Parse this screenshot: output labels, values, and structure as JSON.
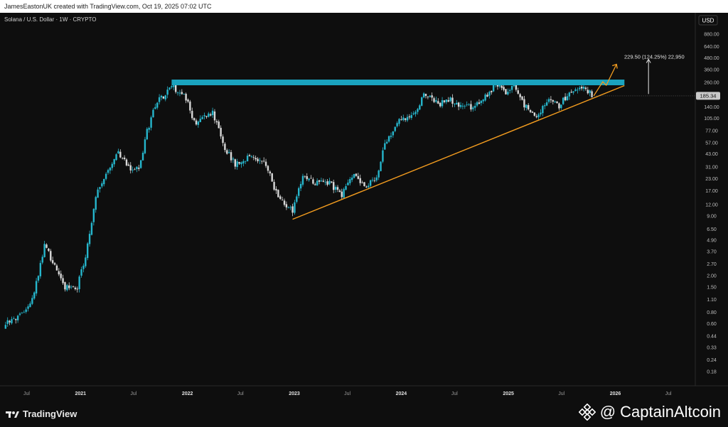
{
  "header": {
    "credit": "JamesEastonUK created with TradingView.com, Oct 19, 2025 07:02 UTC"
  },
  "symbol": {
    "title": "Solana / U.S. Dollar · 1W · CRYPTO"
  },
  "currency_button": "USD",
  "price_tag": "185.34",
  "projection_label": "229.50 (124.25%) 22,950",
  "footer": {
    "tv_brand": "TradingView",
    "watermark": "@ CaptainAltcoin"
  },
  "colors": {
    "background": "#0e0e0e",
    "candle_up": "#26b6cc",
    "candle_down": "#d9d9d9",
    "resistance": "#1aa3bf",
    "trendline": "#f39c1f"
  },
  "chart_data": {
    "type": "candlestick",
    "title": "Solana / U.S. Dollar · 1W · CRYPTO",
    "y_scale": "log",
    "ylim": [
      0.15,
      1300
    ],
    "y_ticks": [
      0.18,
      0.24,
      0.33,
      0.44,
      0.6,
      0.8,
      1.1,
      1.5,
      2.0,
      2.7,
      3.7,
      4.9,
      6.5,
      9.0,
      12.0,
      17.0,
      23.0,
      31.0,
      43.0,
      57.0,
      77.0,
      105.0,
      140.0,
      190.0,
      260.0,
      360.0,
      480.0,
      640.0,
      880.0
    ],
    "x_ticks": [
      "Jul",
      "2021",
      "Jul",
      "2022",
      "Jul",
      "2023",
      "Jul",
      "2024",
      "Jul",
      "2025",
      "Jul",
      "2026",
      "Jul"
    ],
    "x_tick_dates": [
      "2020-07-01",
      "2021-01-01",
      "2021-07-01",
      "2022-01-01",
      "2022-07-01",
      "2023-01-01",
      "2023-07-01",
      "2024-01-01",
      "2024-07-01",
      "2025-01-01",
      "2025-07-01",
      "2026-01-01",
      "2026-07-01"
    ],
    "x_range": [
      "2020-04-01",
      "2026-10-01"
    ],
    "anchors": [
      [
        "2020-04-20",
        0.6
      ],
      [
        "2020-06-01",
        0.7
      ],
      [
        "2020-07-20",
        1.1
      ],
      [
        "2020-08-31",
        4.2
      ],
      [
        "2020-10-12",
        2.4
      ],
      [
        "2020-11-09",
        1.5
      ],
      [
        "2020-12-21",
        1.5
      ],
      [
        "2021-01-25",
        4.2
      ],
      [
        "2021-02-22",
        15
      ],
      [
        "2021-04-05",
        30
      ],
      [
        "2021-05-10",
        45
      ],
      [
        "2021-06-14",
        30
      ],
      [
        "2021-07-19",
        30
      ],
      [
        "2021-08-16",
        75
      ],
      [
        "2021-09-13",
        150
      ],
      [
        "2021-11-08",
        235
      ],
      [
        "2021-12-27",
        175
      ],
      [
        "2022-01-24",
        95
      ],
      [
        "2022-03-28",
        120
      ],
      [
        "2022-05-09",
        50
      ],
      [
        "2022-06-13",
        33
      ],
      [
        "2022-08-08",
        40
      ],
      [
        "2022-09-26",
        33
      ],
      [
        "2022-11-07",
        14
      ],
      [
        "2022-12-26",
        10
      ],
      [
        "2023-01-30",
        24
      ],
      [
        "2023-03-13",
        21
      ],
      [
        "2023-05-01",
        21
      ],
      [
        "2023-06-12",
        15
      ],
      [
        "2023-07-17",
        25
      ],
      [
        "2023-09-04",
        20
      ],
      [
        "2023-10-09",
        23
      ],
      [
        "2023-11-06",
        55
      ],
      [
        "2023-12-25",
        105
      ],
      [
        "2024-02-12",
        110
      ],
      [
        "2024-03-18",
        190
      ],
      [
        "2024-05-06",
        150
      ],
      [
        "2024-06-10",
        170
      ],
      [
        "2024-08-05",
        140
      ],
      [
        "2024-09-09",
        140
      ],
      [
        "2024-11-18",
        240
      ],
      [
        "2024-12-30",
        200
      ],
      [
        "2025-01-20",
        250
      ],
      [
        "2025-02-24",
        150
      ],
      [
        "2025-04-07",
        110
      ],
      [
        "2025-05-19",
        175
      ],
      [
        "2025-06-23",
        145
      ],
      [
        "2025-07-21",
        190
      ],
      [
        "2025-08-25",
        210
      ],
      [
        "2025-09-15",
        240
      ],
      [
        "2025-10-13",
        185
      ]
    ],
    "resistance": {
      "value": 260,
      "from": "2021-11-08",
      "to": "2026-02-01"
    },
    "trendline": {
      "from_date": "2022-12-26",
      "from_value": 8.3,
      "to_date": "2026-02-01",
      "to_value": 240
    },
    "projection": {
      "from_date": "2025-10-19",
      "from_value": 185,
      "target_value": 410,
      "end_date": "2026-01-05"
    }
  }
}
